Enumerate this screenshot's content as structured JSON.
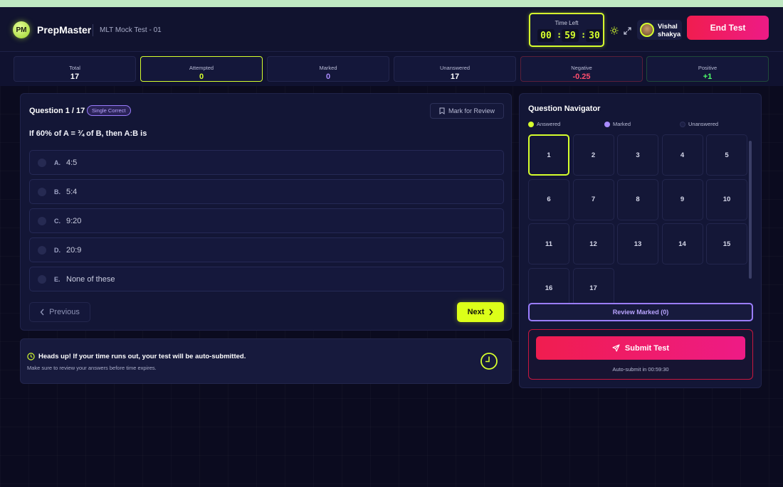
{
  "header": {
    "logo_initials": "PM",
    "brand": "PrepMaster",
    "test_name": "MLT Mock Test - 01",
    "timer": {
      "label": "Time Left",
      "hours": "00",
      "minutes": "59",
      "seconds": "30"
    },
    "user_name_first": "Vishal",
    "user_name_last": "shakya",
    "end_button": "End Test",
    "icons": [
      "sun-icon",
      "fullscreen-icon"
    ]
  },
  "stats": [
    {
      "label": "Total",
      "value": "17",
      "color": "#ffffff"
    },
    {
      "label": "Attempted",
      "value": "0",
      "color": "#d6ff2d",
      "border": "#d6ff2d"
    },
    {
      "label": "Marked",
      "value": "0",
      "color": "#a98bff"
    },
    {
      "label": "Unanswered",
      "value": "17",
      "color": "#ffffff"
    },
    {
      "label": "Negative",
      "value": "-0.25",
      "color": "#ff4d6d",
      "border": "#5a1f3a"
    },
    {
      "label": "Positive",
      "value": "+1",
      "color": "#4dff6a",
      "border": "#1f4a3a"
    }
  ],
  "question": {
    "title": "Question 1 / 17",
    "badge": "Single Correct",
    "mark_label": "Mark for Review",
    "text": "If 60% of A = ¾ of B, then A:B is",
    "options": [
      {
        "letter": "A.",
        "text": "4:5"
      },
      {
        "letter": "B.",
        "text": "5:4"
      },
      {
        "letter": "C.",
        "text": "9:20"
      },
      {
        "letter": "D.",
        "text": "20:9"
      },
      {
        "letter": "E.",
        "text": "None of these"
      }
    ],
    "previous_label": "Previous",
    "next_label": "Next"
  },
  "notice": {
    "title": "Heads up! If your time runs out, your test will be auto-submitted.",
    "subtitle": "Make sure to review your answers before time expires."
  },
  "navigator": {
    "title": "Question Navigator",
    "legend": [
      {
        "label": "Answered",
        "color": "#d6ff2d"
      },
      {
        "label": "Marked",
        "color": "#a98bff"
      },
      {
        "label": "Unanswered",
        "color": "#1c1f44"
      }
    ],
    "questions": [
      "1",
      "2",
      "3",
      "4",
      "5",
      "6",
      "7",
      "8",
      "9",
      "10",
      "11",
      "12",
      "13",
      "14",
      "15",
      "16",
      "17"
    ],
    "current": "1",
    "review_label": "Review Marked (0)",
    "submit_label": "Submit Test",
    "auto_submit": "Auto-submit in 00:59:30"
  },
  "colors": {
    "accent": "#d6ff2d",
    "danger": "#f01d4f",
    "purple": "#9b7dff"
  }
}
